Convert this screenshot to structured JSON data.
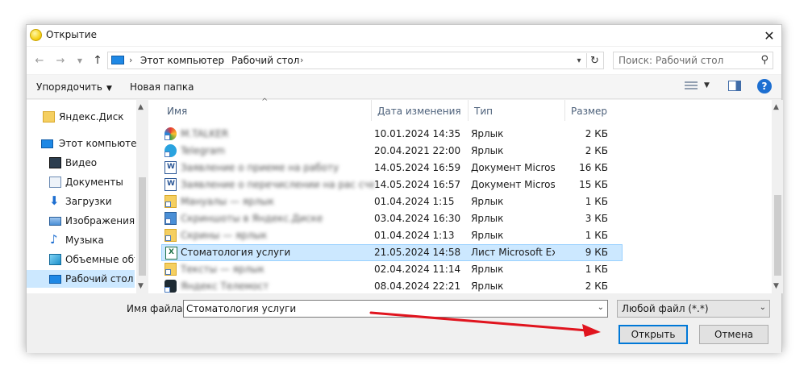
{
  "window": {
    "title": "Открытие",
    "close_glyph": "✕"
  },
  "address": {
    "crumbs": [
      "Этот компьютер",
      "Рабочий стол"
    ],
    "search_placeholder": "Поиск: Рабочий стол"
  },
  "toolbar": {
    "organize_label": "Упорядочить",
    "new_folder_label": "Новая папка",
    "help_glyph": "?"
  },
  "nav": {
    "items": [
      {
        "label": "Яндекс.Диск",
        "icon": "yandex-disk-icon"
      },
      {
        "label": "Этот компьютер",
        "icon": "this-pc-icon"
      },
      {
        "label": "Видео",
        "icon": "video-icon"
      },
      {
        "label": "Документы",
        "icon": "documents-icon"
      },
      {
        "label": "Загрузки",
        "icon": "downloads-icon"
      },
      {
        "label": "Изображения",
        "icon": "pictures-icon"
      },
      {
        "label": "Музыка",
        "icon": "music-icon"
      },
      {
        "label": "Объемные объ",
        "icon": "3d-objects-icon"
      },
      {
        "label": "Рабочий стол",
        "icon": "desktop-icon",
        "selected": true
      }
    ]
  },
  "columns": {
    "name": "Имя",
    "date": "Дата изменения",
    "type": "Тип",
    "size": "Размер"
  },
  "files": [
    {
      "name": "M.TALKER",
      "date": "10.01.2024 14:35",
      "type": "Ярлык",
      "size": "2 КБ",
      "icon": "app-shortcut-icon",
      "blurred": true
    },
    {
      "name": "Telegram",
      "date": "20.04.2021 22:00",
      "type": "Ярлык",
      "size": "2 КБ",
      "icon": "telegram-icon",
      "blurred": true
    },
    {
      "name": "Заявление о приеме на работу",
      "date": "14.05.2024 16:59",
      "type": "Документ Micros...",
      "size": "16 КБ",
      "icon": "word-document-icon",
      "blurred": true
    },
    {
      "name": "Заявление о перечислении на рас счет",
      "date": "14.05.2024 16:57",
      "type": "Документ Micros...",
      "size": "15 КБ",
      "icon": "word-document-icon",
      "blurred": true
    },
    {
      "name": "Мануалы — ярлык",
      "date": "01.04.2024 1:15",
      "type": "Ярлык",
      "size": "1 КБ",
      "icon": "folder-shortcut-icon",
      "blurred": true
    },
    {
      "name": "Скриншоты в Яндекс.Диске",
      "date": "03.04.2024 16:30",
      "type": "Ярлык",
      "size": "3 КБ",
      "icon": "image-shortcut-icon",
      "blurred": true
    },
    {
      "name": "Скрины — ярлык",
      "date": "01.04.2024 1:13",
      "type": "Ярлык",
      "size": "1 КБ",
      "icon": "folder-shortcut-icon",
      "blurred": true
    },
    {
      "name": "Стоматология услуги",
      "date": "21.05.2024 14:58",
      "type": "Лист Microsoft Ex...",
      "size": "9 КБ",
      "icon": "excel-sheet-icon",
      "blurred": false,
      "selected": true
    },
    {
      "name": "Тексты — ярлык",
      "date": "02.04.2024 11:14",
      "type": "Ярлык",
      "size": "1 КБ",
      "icon": "folder-shortcut-icon",
      "blurred": true
    },
    {
      "name": "Яндекс Телемост",
      "date": "08.04.2024 22:21",
      "type": "Ярлык",
      "size": "2 КБ",
      "icon": "app-shortcut-icon",
      "blurred": true
    }
  ],
  "footer": {
    "filename_label": "Имя файла:",
    "filename_value": "Стоматология услуги",
    "filter_value": "Любой файл (*.*)",
    "open_label": "Открыть",
    "cancel_label": "Отмена"
  },
  "colors": {
    "selection": "#cce8ff",
    "accent": "#0078d7",
    "annotation_arrow": "#e0141e"
  }
}
